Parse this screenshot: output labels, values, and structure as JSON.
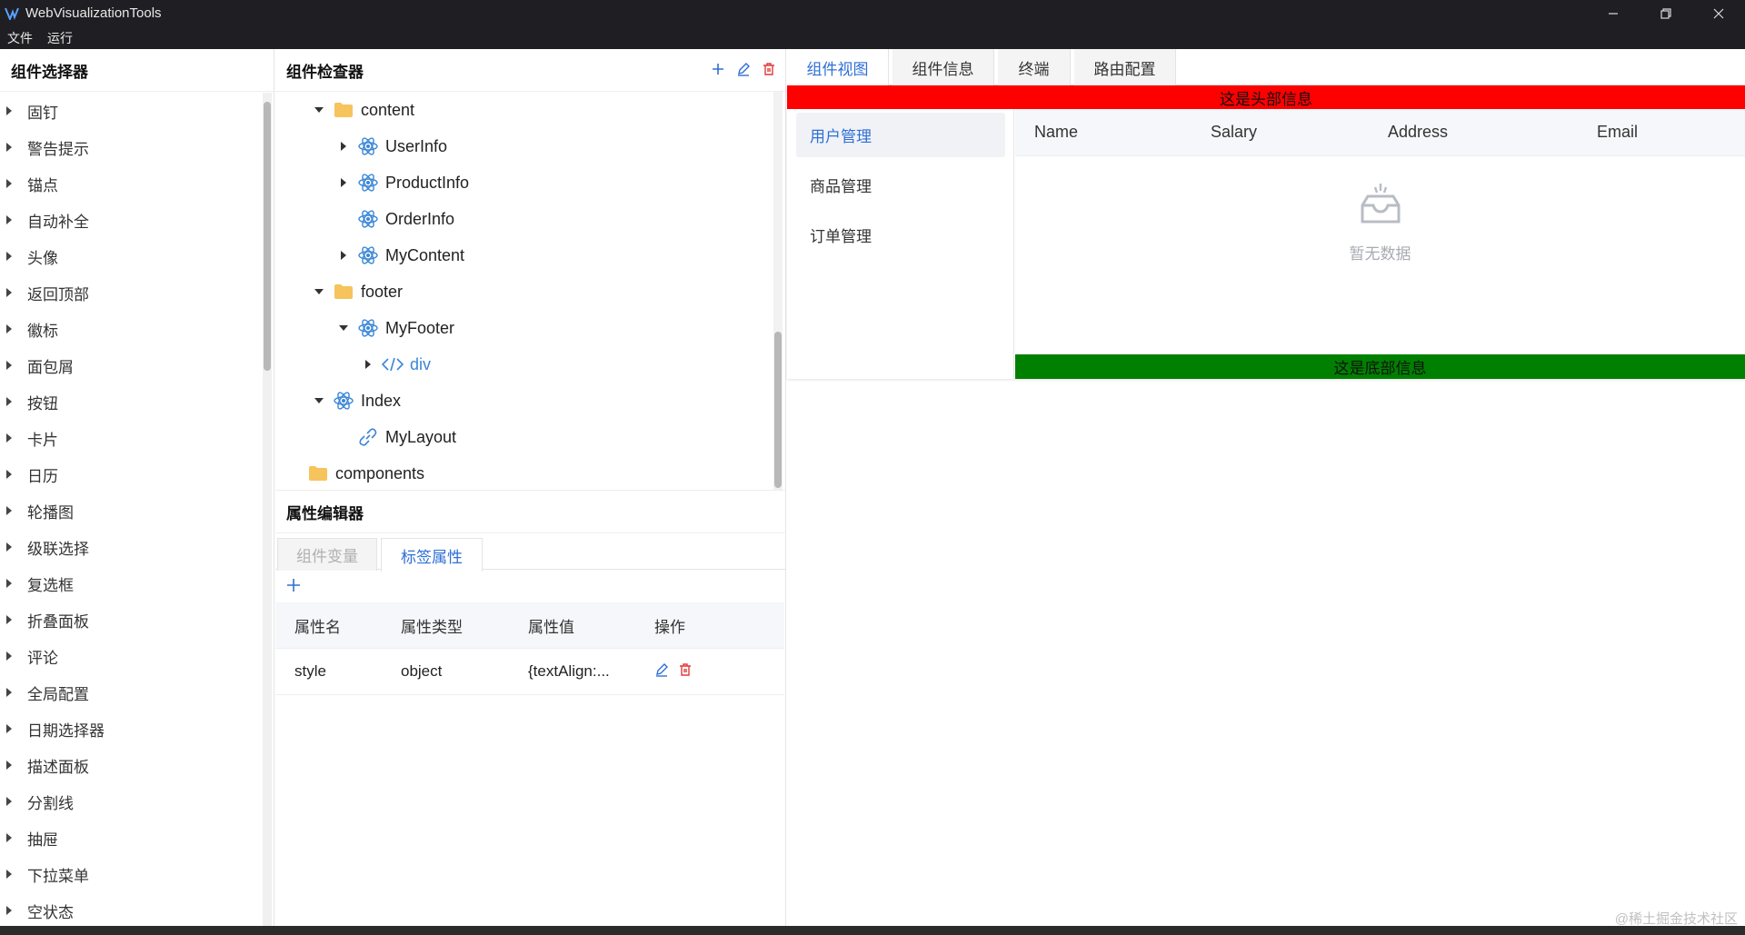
{
  "app": {
    "title": "WebVisualizationTools"
  },
  "menubar": {
    "items": [
      "文件",
      "运行"
    ]
  },
  "left_panel": {
    "title": "组件选择器",
    "items": [
      "固钉",
      "警告提示",
      "锚点",
      "自动补全",
      "头像",
      "返回顶部",
      "徽标",
      "面包屑",
      "按钮",
      "卡片",
      "日历",
      "轮播图",
      "级联选择",
      "复选框",
      "折叠面板",
      "评论",
      "全局配置",
      "日期选择器",
      "描述面板",
      "分割线",
      "抽屉",
      "下拉菜单",
      "空状态"
    ]
  },
  "inspector": {
    "title": "组件检查器",
    "nodes": [
      {
        "label": "content",
        "type": "folder",
        "caret": "down"
      },
      {
        "label": "UserInfo",
        "type": "react",
        "caret": "right"
      },
      {
        "label": "ProductInfo",
        "type": "react",
        "caret": "right"
      },
      {
        "label": "OrderInfo",
        "type": "react",
        "caret": "none"
      },
      {
        "label": "MyContent",
        "type": "react",
        "caret": "right"
      },
      {
        "label": "footer",
        "type": "folder",
        "caret": "down"
      },
      {
        "label": "MyFooter",
        "type": "react",
        "caret": "down"
      },
      {
        "label": "div",
        "type": "code",
        "caret": "right"
      },
      {
        "label": "Index",
        "type": "react",
        "caret": "down"
      },
      {
        "label": "MyLayout",
        "type": "link",
        "caret": "none"
      },
      {
        "label": "components",
        "type": "folder",
        "caret": "none"
      }
    ]
  },
  "prop_editor": {
    "title": "属性编辑器",
    "tabs": {
      "inactive": "组件变量",
      "active": "标签属性"
    },
    "columns": [
      "属性名",
      "属性类型",
      "属性值",
      "操作"
    ],
    "rows": [
      {
        "name": "style",
        "type": "object",
        "value": "{textAlign:..."
      }
    ]
  },
  "right_tabs": [
    "组件视图",
    "组件信息",
    "终端",
    "路由配置"
  ],
  "preview": {
    "header_text": "这是头部信息",
    "footer_text": "这是底部信息",
    "menu": [
      "用户管理",
      "商品管理",
      "订单管理"
    ],
    "table_columns": [
      "Name",
      "Salary",
      "Address",
      "Email"
    ],
    "empty_text": "暂无数据"
  },
  "watermark": "@稀土掘金技术社区",
  "colors": {
    "accent": "#2f6fd6",
    "danger": "#e03a3a",
    "header_banner": "#ff0000",
    "footer_banner": "#008000",
    "folder": "#f6c35c",
    "react": "#3a86d6"
  }
}
